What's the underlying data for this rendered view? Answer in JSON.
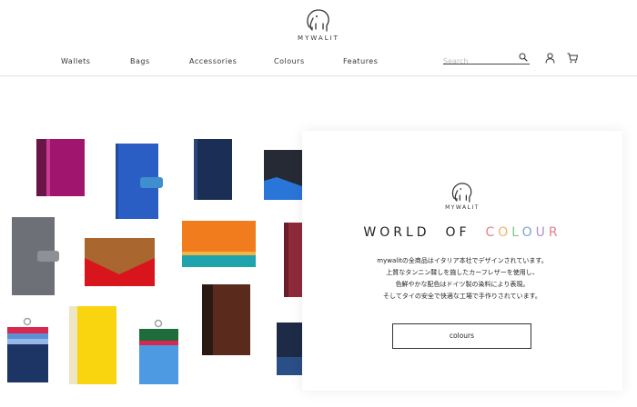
{
  "header": {
    "brand": "MYWALIT",
    "nav": [
      {
        "label": "Wallets"
      },
      {
        "label": "Bags"
      },
      {
        "label": "Accessories"
      },
      {
        "label": "Colours"
      },
      {
        "label": "Features"
      }
    ],
    "search": {
      "placeholder": "Search",
      "value": ""
    }
  },
  "hero": {
    "brand": "MYWALIT",
    "title": {
      "world": "WORLD",
      "of": "OF",
      "colour_letters": [
        "C",
        "O",
        "L",
        "O",
        "U",
        "R"
      ]
    },
    "text_lines": [
      "mywalitの全商品はイタリア本社でデザインされています。",
      "上質なタンニン鞣しを施したカーフレザーを使用し、",
      "色鮮やかな配色はドイツ製の染料により表現。",
      "そしてタイの安全で快適な工場で手作りされています。"
    ],
    "button_label": "colours"
  },
  "colors": {
    "accent_pink": "#e97e8f",
    "accent_orange": "#f0b46a",
    "accent_green": "#7fc38c",
    "accent_blue": "#7da2d6",
    "accent_purple": "#b68bd0"
  }
}
